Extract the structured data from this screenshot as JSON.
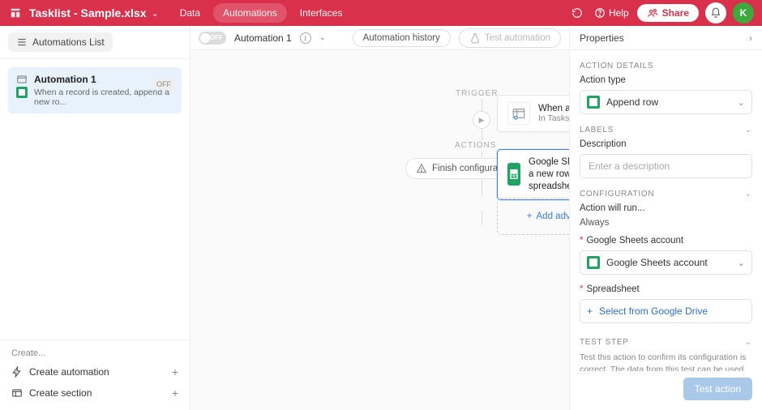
{
  "header": {
    "title": "Tasklist - Sample.xlsx",
    "tabs": {
      "data": "Data",
      "automations": "Automations",
      "interfaces": "Interfaces"
    },
    "help": "Help",
    "share": "Share",
    "avatar": "K"
  },
  "sidebar": {
    "list_button": "Automations List",
    "items": [
      {
        "name": "Automation 1",
        "desc": "When a record is created, append a new ro...",
        "badge": "OFF"
      }
    ],
    "footer": {
      "create": "Create...",
      "create_automation": "Create automation",
      "create_section": "Create section"
    }
  },
  "centerbar": {
    "toggle": "OFF",
    "name": "Automation 1",
    "history": "Automation history",
    "test": "Test automation"
  },
  "canvas": {
    "trigger_label": "TRIGGER",
    "actions_label": "ACTIONS",
    "trigger": {
      "title": "When a record is created",
      "sub": "In Tasks"
    },
    "action": {
      "title": "Google Sheets: Append a new row to a spreadsheet"
    },
    "finish": "Finish configuration",
    "add": "Add advanced logic or action"
  },
  "right": {
    "title": "Properties",
    "action_details": "ACTION DETAILS",
    "action_type": "Action type",
    "action_type_value": "Append row",
    "labels": "LABELS",
    "description": "Description",
    "description_placeholder": "Enter a description",
    "configuration": "CONFIGURATION",
    "run_label": "Action will run...",
    "run_value": "Always",
    "gs_account_label": "Google Sheets account",
    "gs_account_value": "Google Sheets account",
    "spreadsheet_label": "Spreadsheet",
    "spreadsheet_select": "Select from Google Drive",
    "test_step": "TEST STEP",
    "test_note": "Test this action to confirm its configuration is correct. The data from this test can be used in later steps.",
    "test_button": "Test action"
  }
}
